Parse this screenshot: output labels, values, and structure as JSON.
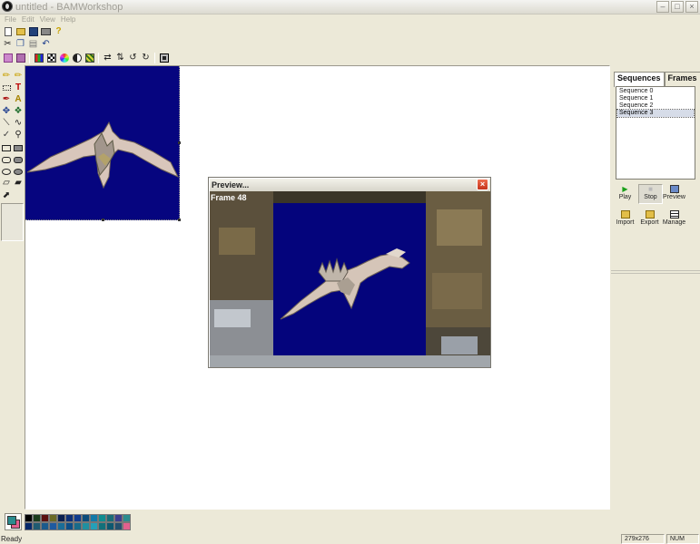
{
  "window": {
    "title": "untitled - BAMWorkshop"
  },
  "menubar": {
    "items": [
      "File",
      "Edit",
      "View",
      "Help"
    ]
  },
  "preview": {
    "title": "Preview...",
    "frame_label": "Frame 48"
  },
  "panel": {
    "tabs": [
      "Sequences",
      "Frames"
    ],
    "sequences": [
      "Sequence 0",
      "Sequence 1",
      "Sequence 2",
      "Sequence 3"
    ],
    "selected_sequence": "Sequence 3",
    "buttons": {
      "play": "Play",
      "stop": "Stop",
      "preview": "Preview",
      "import": "Import",
      "export": "Export",
      "manage": "Manage"
    }
  },
  "palette": {
    "foreground": "#2b8c8e",
    "background": "#e2608e",
    "row1": [
      "#000000",
      "#1b3d1d",
      "#5b1010",
      "#6a6a24",
      "#0a2050",
      "#0c2f76",
      "#0f3b8c",
      "#0c4c7a",
      "#127aa8",
      "#0f8d90",
      "#1a6d78",
      "#3b3f8d",
      "#2b8c8e"
    ],
    "row2": [
      "#06286a",
      "#205b71",
      "#1b5a8c",
      "#1e5aa0",
      "#1a6d98",
      "#0c4e88",
      "#186b8a",
      "#2090a0",
      "#24a0b8",
      "#13707a",
      "#0d5870",
      "#24506e",
      "#e2608e"
    ]
  },
  "status": {
    "text": "Ready",
    "size": "279x276",
    "num": "NUM"
  }
}
